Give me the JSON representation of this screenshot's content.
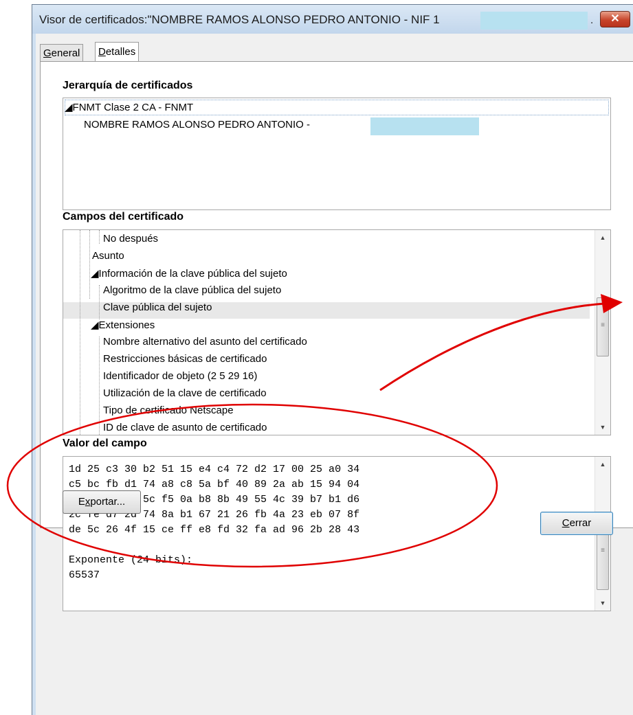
{
  "window": {
    "title": "Visor de certificados:\"NOMBRE RAMOS ALONSO PEDRO ANTONIO - NIF 1",
    "title_suffix": ".",
    "close_glyph": "✕"
  },
  "tabs": {
    "general": {
      "first": "G",
      "rest": "eneral"
    },
    "detalles": {
      "first": "D",
      "rest": "etalles"
    }
  },
  "hierarchy": {
    "label": "Jerarquía de certificados",
    "items": [
      {
        "text": "◢FNMT Clase 2 CA - FNMT"
      },
      {
        "text": "NOMBRE RAMOS ALONSO PEDRO ANTONIO -"
      }
    ]
  },
  "fields": {
    "label": "Campos del certificado",
    "items": [
      "No después",
      "Asunto",
      "◢Información de la clave pública del sujeto",
      "Algoritmo de la clave pública del sujeto",
      "Clave pública del sujeto",
      "◢Extensiones",
      "Nombre alternativo del asunto del certificado",
      "Restricciones básicas de certificado",
      "Identificador de objeto (2 5 29 16)",
      "Utilización de la clave de certificado",
      "Tipo de certificado Netscape",
      "ID de clave de asunto de certificado"
    ]
  },
  "value": {
    "label": "Valor del campo",
    "lines": [
      "1d 25 c3 30 b2 51 15 e4 c4 72 d2 17 00 25 a0 34",
      "c5 bc fb d1 74 a8 c8 5a bf 40 89 2a ab 15 94 04",
      "05 c9 05 fd 5c f5 0a b8 8b 49 55 4c 39 b7 b1 d6",
      "2c fe d7 2d 74 8a b1 67 21 26 fb 4a 23 eb 07 8f",
      "de 5c 26 4f 15 ce ff e8 fd 32 fa ad 96 2b 28 43",
      "",
      "Exponente (24 bits):",
      "65537"
    ]
  },
  "buttons": {
    "export": {
      "first": "E",
      "underlined": "x",
      "rest": "portar..."
    },
    "close": {
      "first": "C",
      "rest": "errar"
    }
  },
  "scroll_glyphs": {
    "up": "▲",
    "down": "▼",
    "grip": "≡"
  },
  "colors": {
    "annotation": "#e00000",
    "redaction": "#b7e1f0"
  }
}
